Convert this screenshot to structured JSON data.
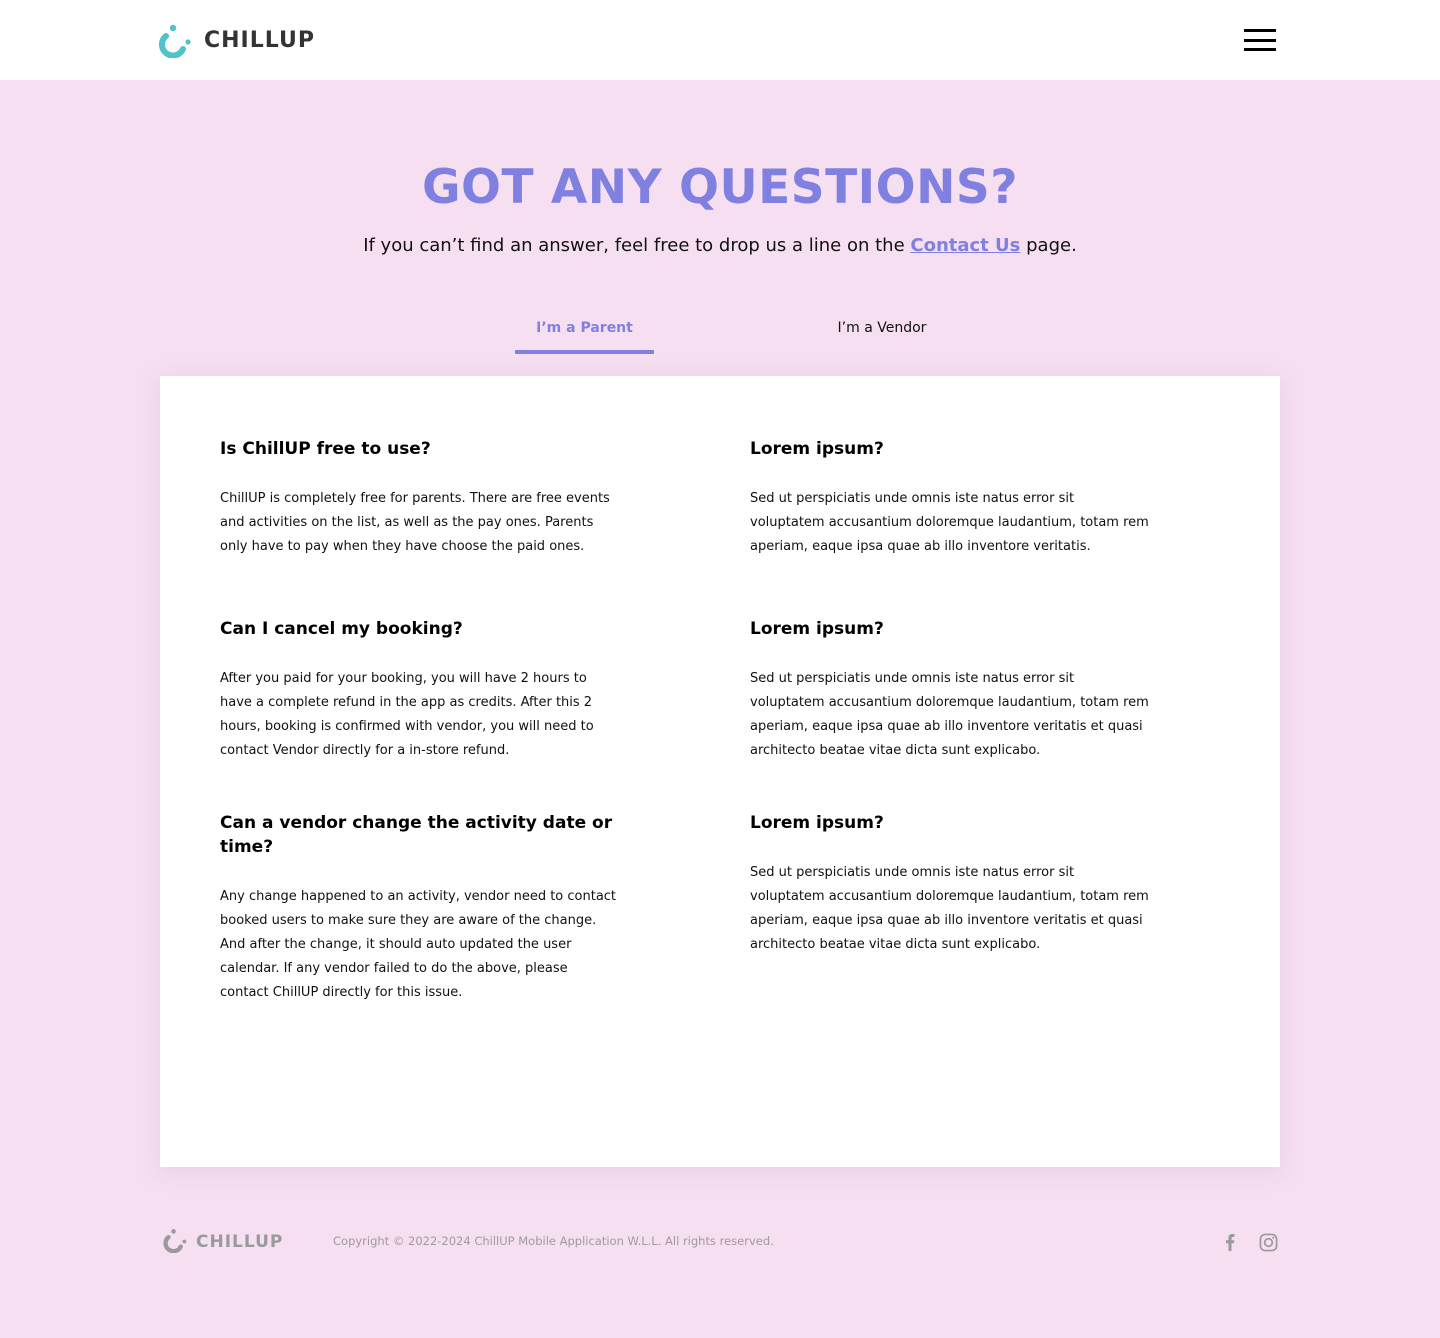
{
  "header": {
    "logo_text": "CHILLUP",
    "menu_icon": "hamburger-icon"
  },
  "hero": {
    "title": "GOT ANY QUESTIONS?",
    "subtitle_before": "If you can’t find an answer, feel free to drop us a line on the ",
    "contact_link": "Contact Us",
    "subtitle_after": " page."
  },
  "tabs": [
    {
      "label": "I’m a Parent",
      "active": true
    },
    {
      "label": "I’m a Vendor",
      "active": false
    }
  ],
  "faq": [
    {
      "question": "Is ChillUP free to use?",
      "answer": "ChillUP is completely free for parents. There are free events and activities on the list, as well as the pay ones. Parents only have to pay when they have choose the paid ones."
    },
    {
      "question": "Lorem ipsum?",
      "answer": "Sed ut perspiciatis unde omnis iste natus error sit voluptatem accusantium doloremque laudantium, totam rem aperiam, eaque ipsa quae ab illo inventore veritatis."
    },
    {
      "question": "Can I cancel my booking?",
      "answer": "After you paid for your booking, you will have 2 hours to have a complete refund in the app as credits. After this 2 hours, booking is confirmed with vendor, you will need to contact Vendor directly for a in-store refund."
    },
    {
      "question": "Lorem ipsum?",
      "answer": "Sed ut perspiciatis unde omnis iste natus error sit voluptatem accusantium doloremque laudantium, totam rem aperiam, eaque ipsa quae ab illo inventore veritatis et quasi architecto beatae vitae dicta sunt explicabo."
    },
    {
      "question": "Can a vendor change the activity date or time?",
      "answer": "Any change happened to an activity, vendor need to contact booked users to make sure they are aware of the change. And after the change, it should auto updated the user calendar. If any vendor failed to do the above, please contact ChillUP directly for this issue."
    },
    {
      "question": "Lorem ipsum?",
      "answer": "Sed ut perspiciatis unde omnis iste natus error sit voluptatem accusantium doloremque laudantium, totam rem aperiam, eaque ipsa quae ab illo inventore veritatis et quasi architecto beatae vitae dicta sunt explicabo."
    }
  ],
  "footer": {
    "logo_text": "CHILLUP",
    "copyright": "Copyright © 2022-2024 ChillUP Mobile Application W.L.L. All rights reserved.",
    "social_icons": [
      "facebook-icon",
      "instagram-icon"
    ]
  },
  "colors": {
    "page_background": "#f5dff0",
    "accent": "#8080e0",
    "logo_teal": "#4fc3c8",
    "card_background": "#ffffff"
  }
}
